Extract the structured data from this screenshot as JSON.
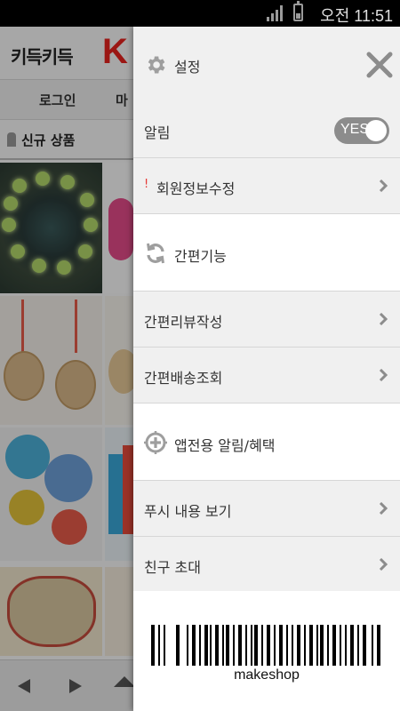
{
  "status_bar": {
    "time": "오전 11:51"
  },
  "background_app": {
    "title": "키득키득",
    "logo": "K",
    "login_label": "로그인",
    "my_label": "마",
    "new_products_label": "신규 상품"
  },
  "drawer": {
    "header": {
      "title": "설정",
      "gear_icon": "gear-icon",
      "close_icon": "close-icon"
    },
    "notification": {
      "label": "알림",
      "toggle_value": "YES"
    },
    "member_edit": {
      "label": "회원정보수정",
      "marker": "!"
    },
    "quick_section": {
      "label": "간편기능",
      "icon": "refresh-icon"
    },
    "quick_items": [
      {
        "label": "간편리뷰작성"
      },
      {
        "label": "간편배송조회"
      }
    ],
    "app_section": {
      "label": "앱전용 알림/혜택",
      "icon": "target-plus-icon"
    },
    "app_items": [
      {
        "label": "푸시 내용 보기"
      },
      {
        "label": "친구 초대"
      }
    ],
    "barcode": {
      "text": "makeshop"
    }
  },
  "colors": {
    "accent_gray": "#8c8c8c",
    "alert_red": "#e53935",
    "logo_red": "#e8231e"
  }
}
